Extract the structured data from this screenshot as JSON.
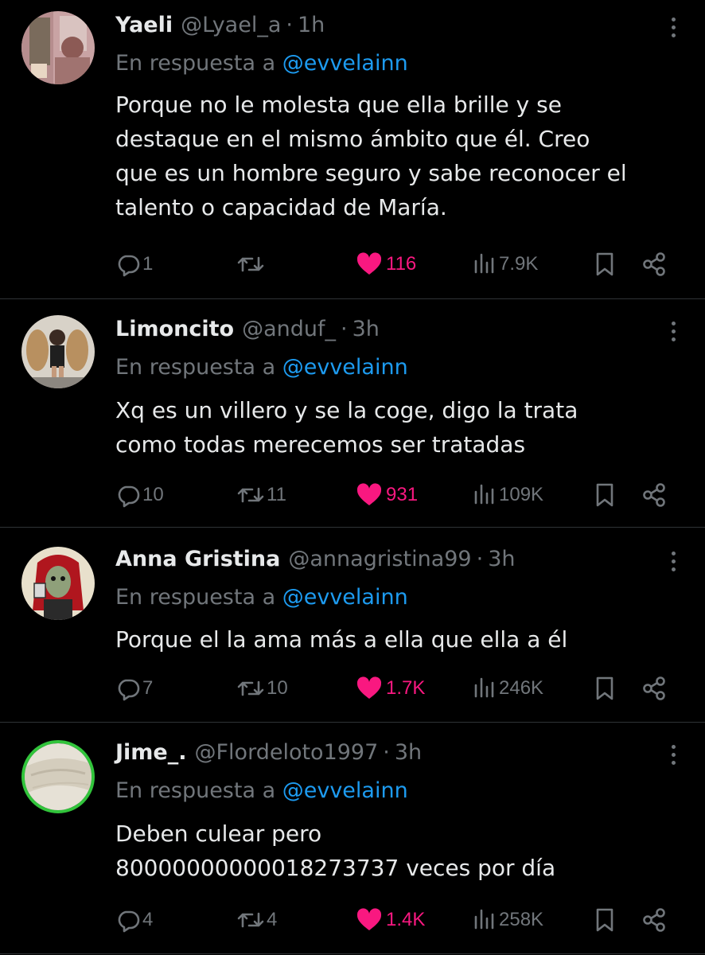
{
  "colors": {
    "background": "#000000",
    "text": "#e7e9ea",
    "muted": "#71767b",
    "link": "#1d9bf0",
    "like": "#f91880",
    "divider": "#2f3336"
  },
  "icons": {
    "reply": "reply-icon",
    "retweet": "retweet-icon",
    "like": "heart-icon",
    "views": "views-icon",
    "bookmark": "bookmark-icon",
    "share": "share-icon",
    "more": "more-icon"
  },
  "tweets": [
    {
      "name": "Yaeli",
      "handle": "@Lyael_a",
      "separator": "·",
      "time": "1h",
      "reply_prefix": "En respuesta a",
      "reply_to": "@evvelainn",
      "lines": [
        "Porque no le molesta que ella brille y se",
        "destaque en el mismo ámbito que él. Creo",
        "que es un hombre seguro y sabe reconocer el",
        "talento o capacidad de María."
      ],
      "replies": "1",
      "retweets": "",
      "likes": "116",
      "liked": true,
      "views": "7.9K"
    },
    {
      "name": "Limoncito",
      "handle": "@anduf_",
      "separator": "·",
      "time": "3h",
      "reply_prefix": "En respuesta a",
      "reply_to": "@evvelainn",
      "lines": [
        "Xq es un villero y se la coge, digo la trata",
        "como todas merecemos ser tratadas"
      ],
      "replies": "10",
      "retweets": "11",
      "likes": "931",
      "liked": true,
      "views": "109K"
    },
    {
      "name": "Anna Gristina",
      "handle": "@annagristina99",
      "separator": "·",
      "time": "3h",
      "reply_prefix": "En respuesta a",
      "reply_to": "@evvelainn",
      "lines": [
        "Porque el la ama más a ella que ella a él"
      ],
      "replies": "7",
      "retweets": "10",
      "likes": "1.7K",
      "liked": true,
      "views": "246K"
    },
    {
      "name": "Jime_.",
      "handle": "@Flordeloto1997",
      "separator": "·",
      "time": "3h",
      "reply_prefix": "En respuesta a",
      "reply_to": "@evvelainn",
      "lines": [
        "Deben culear pero",
        "80000000000018273737 veces por día"
      ],
      "replies": "4",
      "retweets": "4",
      "likes": "1.4K",
      "liked": true,
      "views": "258K"
    }
  ]
}
